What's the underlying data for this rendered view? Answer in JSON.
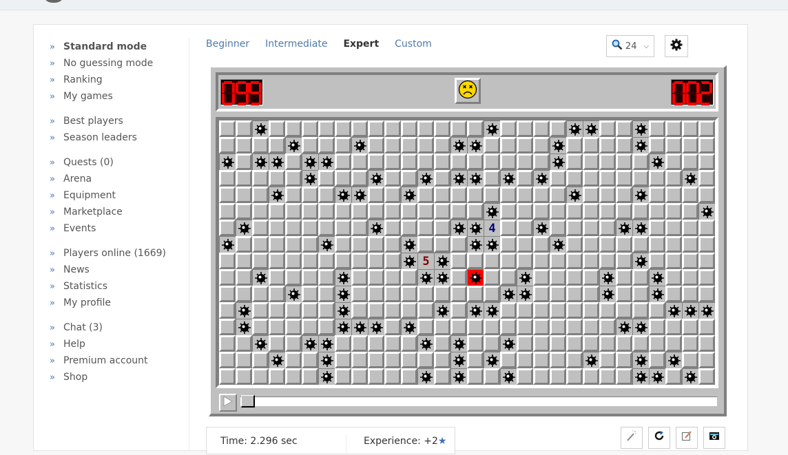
{
  "sidebar": {
    "groups": [
      [
        {
          "label": "Standard mode",
          "active": true
        },
        {
          "label": "No guessing mode"
        },
        {
          "label": "Ranking"
        },
        {
          "label": "My games"
        }
      ],
      [
        {
          "label": "Best players"
        },
        {
          "label": "Season leaders"
        }
      ],
      [
        {
          "label": "Quests (0)"
        },
        {
          "label": "Arena"
        },
        {
          "label": "Equipment"
        },
        {
          "label": "Marketplace"
        },
        {
          "label": "Events"
        }
      ],
      [
        {
          "label": "Players online (1669)"
        },
        {
          "label": "News"
        },
        {
          "label": "Statistics"
        },
        {
          "label": "My profile"
        }
      ],
      [
        {
          "label": "Chat (3)"
        },
        {
          "label": "Help"
        },
        {
          "label": "Premium account"
        },
        {
          "label": "Shop"
        }
      ]
    ]
  },
  "tabs": [
    {
      "label": "Beginner"
    },
    {
      "label": "Intermediate"
    },
    {
      "label": "Expert",
      "active": true
    },
    {
      "label": "Custom"
    }
  ],
  "zoom_select": {
    "value": "24",
    "icon": "magnifier-icon"
  },
  "game": {
    "mines_counter": "099",
    "timer_counter": "002",
    "face": "dead",
    "rows": 16,
    "cols": 30,
    "mines": [
      [
        0,
        2
      ],
      [
        1,
        4
      ],
      [
        1,
        8
      ],
      [
        1,
        14
      ],
      [
        2,
        0
      ],
      [
        2,
        2
      ],
      [
        2,
        3
      ],
      [
        2,
        5
      ],
      [
        2,
        6
      ],
      [
        3,
        5
      ],
      [
        3,
        9
      ],
      [
        3,
        12
      ],
      [
        3,
        14
      ],
      [
        4,
        3
      ],
      [
        4,
        7
      ],
      [
        4,
        8
      ],
      [
        4,
        11
      ],
      [
        6,
        1
      ],
      [
        6,
        9
      ],
      [
        6,
        14
      ],
      [
        7,
        0
      ],
      [
        7,
        6
      ],
      [
        7,
        11
      ],
      [
        0,
        16
      ],
      [
        0,
        21
      ],
      [
        0,
        22
      ],
      [
        0,
        25
      ],
      [
        1,
        15
      ],
      [
        1,
        20
      ],
      [
        1,
        25
      ],
      [
        2,
        20
      ],
      [
        2,
        26
      ],
      [
        3,
        15
      ],
      [
        3,
        17
      ],
      [
        3,
        19
      ],
      [
        3,
        28
      ],
      [
        4,
        21
      ],
      [
        4,
        25
      ],
      [
        5,
        16
      ],
      [
        5,
        29
      ],
      [
        6,
        15
      ],
      [
        6,
        19
      ],
      [
        6,
        24
      ],
      [
        6,
        25
      ],
      [
        7,
        15
      ],
      [
        7,
        16
      ],
      [
        7,
        20
      ],
      [
        8,
        11
      ],
      [
        8,
        13
      ],
      [
        9,
        2
      ],
      [
        9,
        7
      ],
      [
        9,
        12
      ],
      [
        9,
        13
      ],
      [
        10,
        4
      ],
      [
        10,
        7
      ],
      [
        11,
        1
      ],
      [
        11,
        7
      ],
      [
        11,
        13
      ],
      [
        12,
        1
      ],
      [
        12,
        7
      ],
      [
        12,
        8
      ],
      [
        12,
        9
      ],
      [
        12,
        11
      ],
      [
        13,
        2
      ],
      [
        13,
        5
      ],
      [
        13,
        6
      ],
      [
        13,
        12
      ],
      [
        13,
        14
      ],
      [
        14,
        3
      ],
      [
        14,
        6
      ],
      [
        14,
        14
      ],
      [
        15,
        6
      ],
      [
        15,
        12
      ],
      [
        15,
        14
      ],
      [
        8,
        25
      ],
      [
        9,
        15
      ],
      [
        9,
        18
      ],
      [
        9,
        23
      ],
      [
        9,
        26
      ],
      [
        10,
        17
      ],
      [
        10,
        18
      ],
      [
        10,
        23
      ],
      [
        10,
        26
      ],
      [
        11,
        15
      ],
      [
        11,
        16
      ],
      [
        11,
        27
      ],
      [
        11,
        28
      ],
      [
        11,
        29
      ],
      [
        12,
        24
      ],
      [
        12,
        25
      ],
      [
        13,
        17
      ],
      [
        14,
        16
      ],
      [
        14,
        22
      ],
      [
        14,
        25
      ],
      [
        14,
        27
      ],
      [
        15,
        17
      ],
      [
        15,
        25
      ],
      [
        15,
        26
      ],
      [
        15,
        28
      ]
    ],
    "exploded": [
      9,
      15
    ],
    "numbers": [
      {
        "row": 6,
        "col": 16,
        "value": "4",
        "color": "#000080"
      },
      {
        "row": 8,
        "col": 12,
        "value": "5",
        "color": "#800000"
      }
    ],
    "replay_progress": 0
  },
  "stats": {
    "time": "Time: 2.296 sec",
    "experience": "Experience: +2"
  },
  "tools": [
    {
      "icon": "magic-wand-icon"
    },
    {
      "icon": "restart-icon"
    },
    {
      "icon": "edit-icon"
    },
    {
      "icon": "camera-icon"
    }
  ]
}
